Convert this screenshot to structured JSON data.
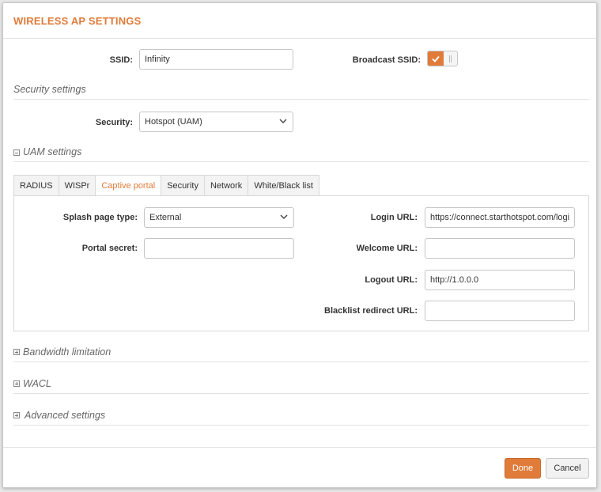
{
  "dialog": {
    "title": "WIRELESS AP SETTINGS",
    "ssid": {
      "label": "SSID:",
      "value": "Infinity"
    },
    "broadcast_ssid": {
      "label": "Broadcast SSID:",
      "enabled": true
    },
    "security_settings": {
      "title": "Security settings",
      "security": {
        "label": "Security:",
        "value": "Hotspot (UAM)"
      }
    },
    "uam_settings": {
      "title": "UAM settings",
      "tabs": [
        "RADIUS",
        "WISPr",
        "Captive portal",
        "Security",
        "Network",
        "White/Black list"
      ],
      "active_tab": "Captive portal",
      "captive_portal": {
        "splash_page_type": {
          "label": "Splash page type:",
          "value": "External"
        },
        "portal_secret": {
          "label": "Portal secret:",
          "value": ""
        },
        "login_url": {
          "label": "Login URL:",
          "value": "https://connect.starthotspot.com/login"
        },
        "welcome_url": {
          "label": "Welcome URL:",
          "value": ""
        },
        "logout_url": {
          "label": "Logout URL:",
          "value": "http://1.0.0.0"
        },
        "blacklist_redirect_url": {
          "label": "Blacklist redirect URL:",
          "value": ""
        }
      }
    },
    "collapsed_sections": [
      "Bandwidth limitation",
      "WACL",
      "Advanced settings"
    ],
    "buttons": {
      "done": "Done",
      "cancel": "Cancel"
    },
    "colors": {
      "accent": "#e07b39"
    }
  }
}
